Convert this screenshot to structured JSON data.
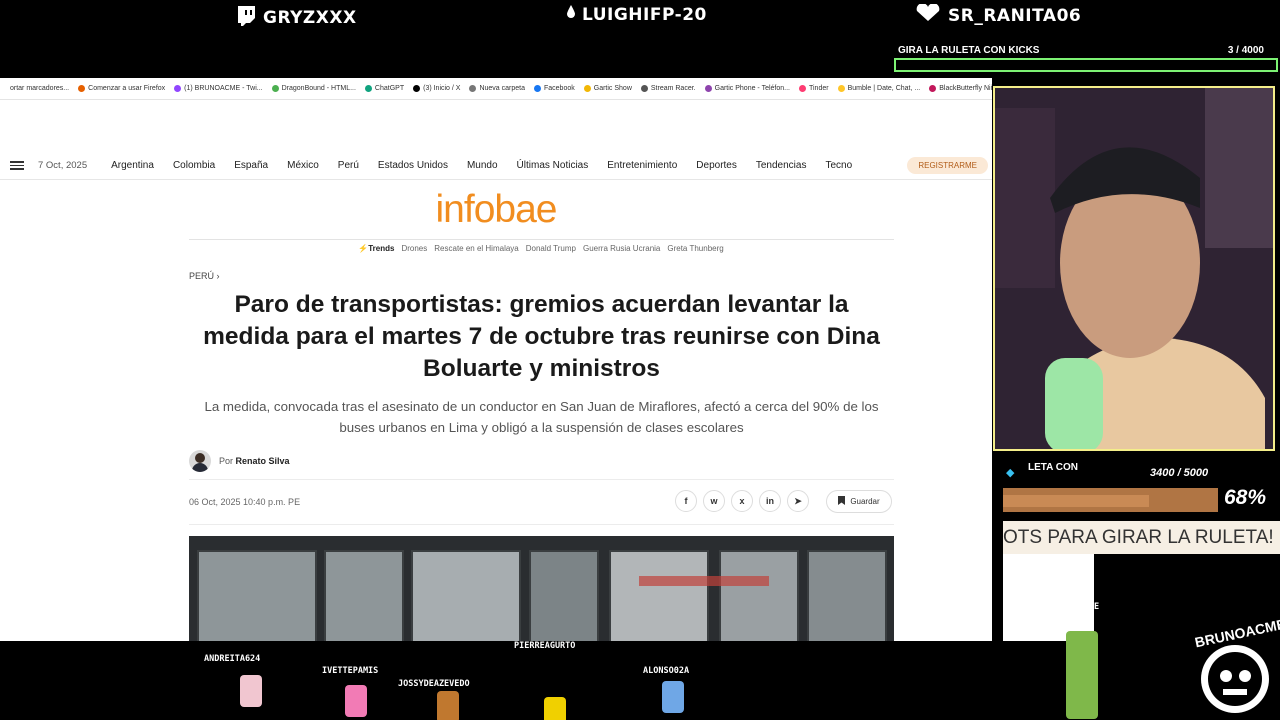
{
  "overlay": {
    "top_names": [
      "GRYZXXX",
      "LUIGHIFP-20",
      "SR_RANITA06"
    ],
    "roulette": {
      "title": "GIRA LA RULETA CON KICKS",
      "count": "3  / 4000"
    },
    "goal": {
      "label": "LETA CON",
      "count": "3400 / 5000",
      "percent": "68%",
      "fill_fraction": 0.68
    },
    "ticker": "OTS PARA GIRAR LA RULETA!",
    "streamer_name": "BRUNOACME",
    "badge_text": "BRUNOACME",
    "viewers": [
      "ANDREITA624",
      "IVETTEPAMIS",
      "JOSSYDEAZEVEDO",
      "PIERREAGURTO",
      "ALONSO02A"
    ]
  },
  "bookmarks": [
    {
      "label": "ortar marcadores...",
      "color": "#ffffff"
    },
    {
      "label": "Comenzar a usar Firefox",
      "color": "#e66000"
    },
    {
      "label": "(1) BRUNOACME - Twi...",
      "color": "#9146ff"
    },
    {
      "label": "DragonBound - HTML...",
      "color": "#4caf50"
    },
    {
      "label": "ChatGPT",
      "color": "#10a37f"
    },
    {
      "label": "(3) Inicio / X",
      "color": "#000000"
    },
    {
      "label": "Nueva carpeta",
      "color": "#777777"
    },
    {
      "label": "Facebook",
      "color": "#1877f2"
    },
    {
      "label": "Gartic Show",
      "color": "#f2b705"
    },
    {
      "label": "Stream Racer.",
      "color": "#555555"
    },
    {
      "label": "Gartic Phone - Teléfon...",
      "color": "#8e44ad"
    },
    {
      "label": "Tinder",
      "color": "#fe3c72"
    },
    {
      "label": "Bumble | Date, Chat, ...",
      "color": "#ffc629"
    },
    {
      "label": "BlackButterfly Niñas ...",
      "color": "#c2185b"
    }
  ],
  "nav": {
    "date": "7 Oct, 2025",
    "items": [
      "Argentina",
      "Colombia",
      "España",
      "México",
      "Perú",
      "Estados Unidos",
      "Mundo",
      "Últimas Noticias",
      "Entretenimiento",
      "Deportes",
      "Tendencias",
      "Tecno"
    ],
    "register": "REGISTRARME"
  },
  "logo": "infobae",
  "trends": {
    "label": "Trends",
    "items": [
      "Drones",
      "Rescate en el Himalaya",
      "Donald Trump",
      "Guerra Rusia Ucrania",
      "Greta Thunberg"
    ]
  },
  "article": {
    "section": "PERÚ ›",
    "headline": "Paro de transportistas: gremios acuerdan levantar la medida para el martes 7 de octubre tras reunirse con Dina Boluarte y ministros",
    "subtitle": "La medida, convocada tras el asesinato de un conductor en San Juan de Miraflores, afectó a cerca del 90% de los buses urbanos en Lima y obligó a la suspensión de clases escolares",
    "author_prefix": "Por",
    "author": "Renato Silva",
    "date": "06 Oct, 2025 10:40 p.m. PE",
    "save": "Guardar",
    "share_icons": [
      "f",
      "w",
      "x",
      "in",
      "➤"
    ]
  },
  "colors": {
    "brand": "#f18d1f",
    "accent_green": "#7df274"
  }
}
